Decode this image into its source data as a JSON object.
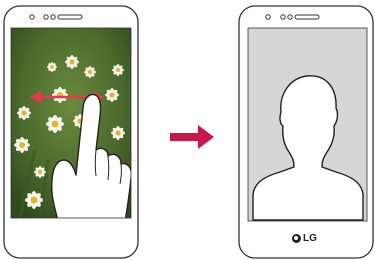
{
  "brand": {
    "name": "LG"
  },
  "colors": {
    "swipe_arrow": "#ee3355",
    "transition_arrow": "#c8174a",
    "photo_background": "#4d6b2e",
    "contact_placeholder": "#d6d6d6"
  },
  "icons": {
    "left_phone_screen": "flower-photo",
    "gesture": "hand-swipe-icon",
    "right_phone_screen": "person-silhouette-icon"
  }
}
